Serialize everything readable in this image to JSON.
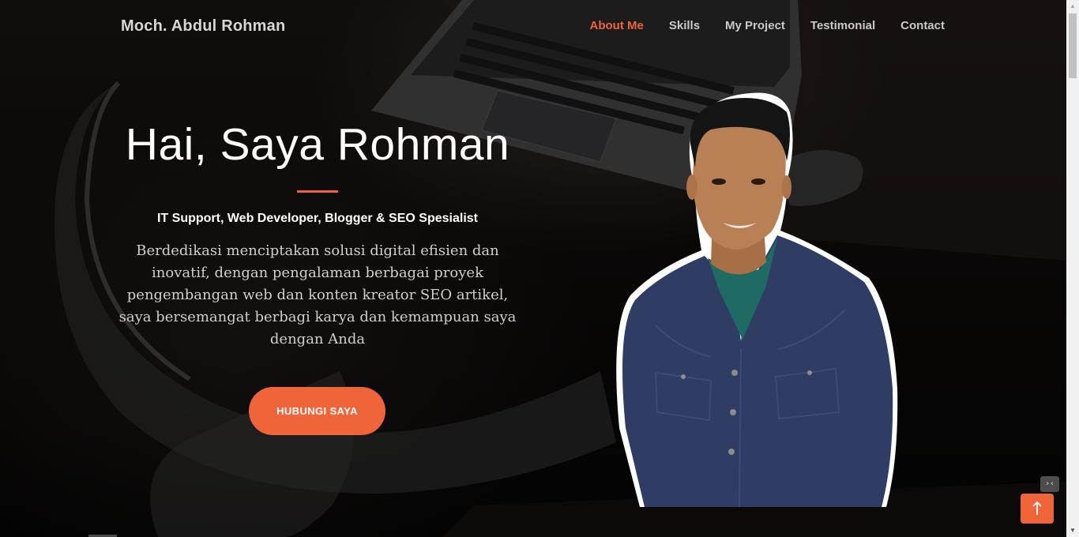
{
  "brand": {
    "name": "Moch. Abdul Rohman"
  },
  "nav": {
    "items": [
      {
        "label": "About Me",
        "active": true
      },
      {
        "label": "Skills"
      },
      {
        "label": "My Project"
      },
      {
        "label": "Testimonial"
      },
      {
        "label": "Contact"
      }
    ]
  },
  "hero": {
    "title": "Hai, Saya Rohman",
    "subtitle": "IT Support, Web Developer, Blogger & SEO Spesialist",
    "description": "Berdedikasi menciptakan solusi digital efisien dan inovatif, dengan pengalaman berbagai proyek pengembangan web dan konten kreator SEO artikel, saya bersemangat berbagi karya dan kemampuan saya dengan Anda",
    "cta_label": "HUBUNGI SAYA"
  },
  "floating": {
    "back_to_top_icon": "arrow-up-icon",
    "mini_tool_icon": "code-collapse-icon",
    "mini_tool_glyph": "›‹"
  },
  "colors": {
    "accent": "#f0643a",
    "nav_text": "#c9c9c9",
    "background": "#0b0908",
    "jacket": "#2f3c63",
    "shirt": "#1f6a62"
  }
}
